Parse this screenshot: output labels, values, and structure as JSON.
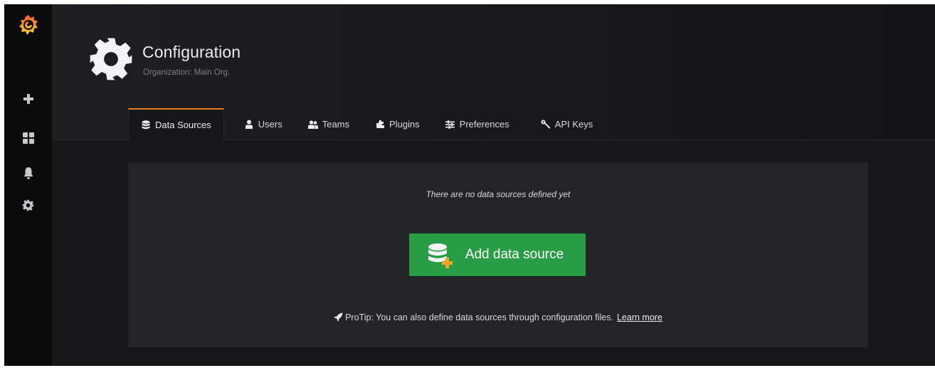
{
  "sidebar": {
    "items": [
      {
        "icon": "grafana-logo-icon"
      },
      {
        "icon": "plus-icon"
      },
      {
        "icon": "dashboards-icon"
      },
      {
        "icon": "bell-icon"
      },
      {
        "icon": "gear-icon"
      }
    ]
  },
  "header": {
    "title": "Configuration",
    "subtitle": "Organization: Main Org."
  },
  "tabs": [
    {
      "label": "Data Sources",
      "icon": "database-icon",
      "active": true
    },
    {
      "label": "Users",
      "icon": "user-icon"
    },
    {
      "label": "Teams",
      "icon": "users-icon"
    },
    {
      "label": "Plugins",
      "icon": "plug-icon"
    },
    {
      "label": "Preferences",
      "icon": "sliders-icon"
    },
    {
      "label": "API Keys",
      "icon": "key-icon"
    }
  ],
  "empty_state": {
    "message": "There are no data sources defined yet",
    "button_label": "Add data source",
    "protip_text": "ProTip: You can also define data sources through configuration files.",
    "learn_more": "Learn more"
  },
  "colors": {
    "accent": "#eb7b18",
    "button_green": "#299c46",
    "background": "#161719",
    "panel": "#232427"
  }
}
